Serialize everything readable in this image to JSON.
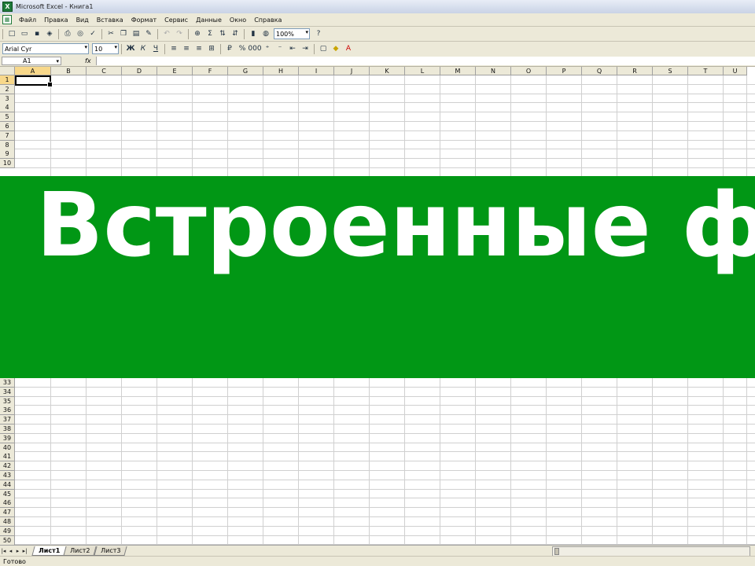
{
  "window": {
    "title": "Microsoft Excel - Книга1",
    "app_icon": "excel-icon"
  },
  "menu": [
    "Файл",
    "Правка",
    "Вид",
    "Вставка",
    "Формат",
    "Сервис",
    "Данные",
    "Окно",
    "Справка"
  ],
  "toolbar_standard": {
    "icons": [
      "new-icon",
      "open-icon",
      "save-icon",
      "permission-icon",
      "print-icon",
      "print-preview-icon",
      "spelling-icon",
      "cut-icon",
      "copy-icon",
      "paste-icon",
      "format-painter-icon",
      "undo-icon",
      "redo-icon",
      "hyperlink-icon",
      "autosum-icon",
      "sort-ascending-icon",
      "sort-descending-icon",
      "chart-wizard-icon",
      "drawing-icon",
      "help-icon"
    ],
    "zoom": "100%"
  },
  "toolbar_formatting": {
    "font": "Arial Cyr",
    "size": "10",
    "icons": [
      "bold-icon",
      "italic-icon",
      "underline-icon",
      "align-left-icon",
      "align-center-icon",
      "align-right-icon",
      "merge-center-icon",
      "currency-icon",
      "percent-icon",
      "comma-icon",
      "increase-decimal-icon",
      "decrease-decimal-icon",
      "decrease-indent-icon",
      "increase-indent-icon",
      "borders-icon",
      "fill-color-icon",
      "font-color-icon"
    ]
  },
  "formula_bar": {
    "name_box": "A1",
    "fx_label": "fx",
    "content": ""
  },
  "sheet": {
    "columns": [
      "A",
      "B",
      "C",
      "D",
      "E",
      "F",
      "G",
      "H",
      "I",
      "J",
      "K",
      "L",
      "M",
      "N",
      "O",
      "P",
      "Q",
      "R",
      "S",
      "T",
      "U"
    ],
    "active_cell": "A1",
    "rows_top": [
      "1",
      "2",
      "3",
      "4",
      "5",
      "6",
      "7",
      "8",
      "9",
      "10"
    ],
    "rows_bottom": [
      "33",
      "34",
      "35",
      "36",
      "37",
      "38",
      "39",
      "40",
      "41",
      "42",
      "43",
      "44",
      "45",
      "46",
      "47",
      "48",
      "49",
      "50"
    ]
  },
  "banner": {
    "text": "Встроенные ф",
    "color": "#019715"
  },
  "tabs": [
    "Лист1",
    "Лист2",
    "Лист3"
  ],
  "active_tab": 0,
  "status": "Готово"
}
